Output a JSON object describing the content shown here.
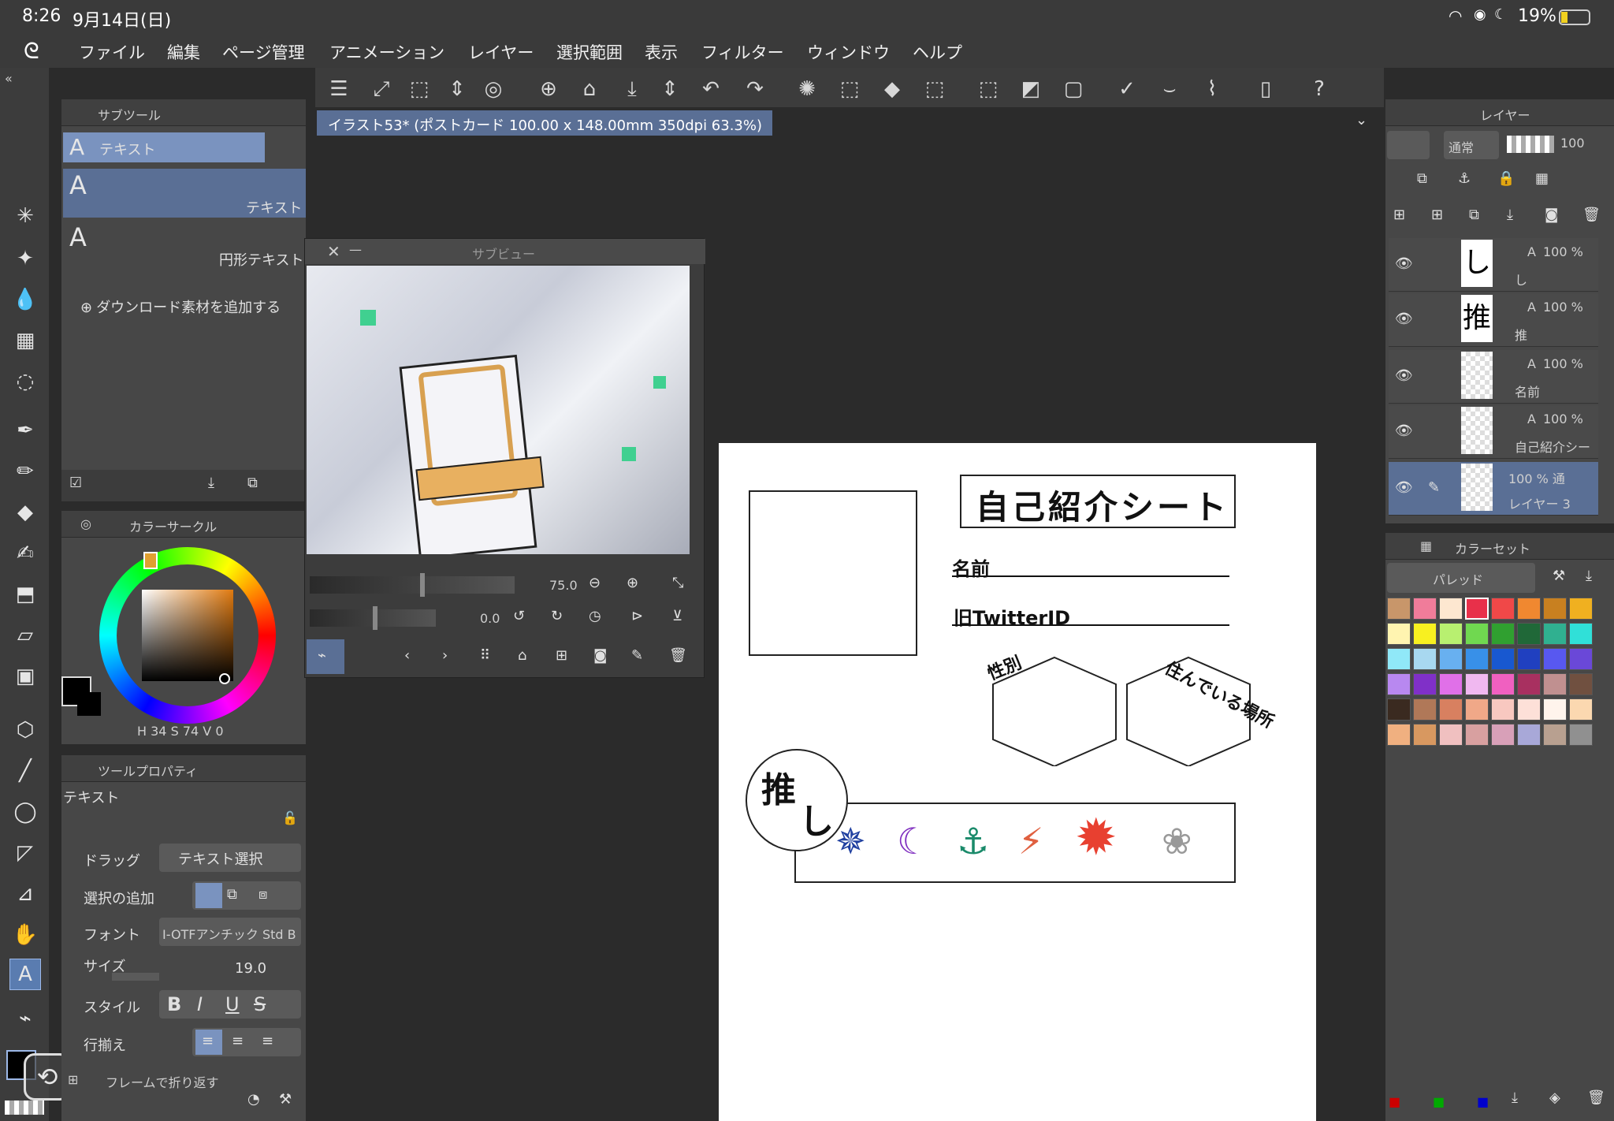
{
  "status": {
    "time": "8:26",
    "date": "9月14日(日)",
    "battery": "19%"
  },
  "menu": [
    "ファイル",
    "編集",
    "ページ管理",
    "アニメーション",
    "レイヤー",
    "選択範囲",
    "表示",
    "フィルター",
    "ウィンドウ",
    "ヘルプ"
  ],
  "document_tab": "イラスト53* (ポストカード 100.00 x 148.00mm 350dpi 63.3%)",
  "subtool": {
    "title": "サブツール",
    "items": [
      "テキスト",
      "テキスト",
      "円形テキスト"
    ],
    "add_material": "ダウンロード素材を追加する"
  },
  "subview": {
    "title": "サブビュー",
    "zoom": "75.0",
    "rotation": "0.0"
  },
  "color": {
    "title": "カラーサークル",
    "h": "34",
    "s": "74",
    "v": "0",
    "h_label": "H",
    "s_label": "S",
    "v_label": "V",
    "accent": "#e07a10"
  },
  "toolprop": {
    "title": "ツールプロパティ",
    "tool_name": "テキスト",
    "drag_label": "ドラッグ",
    "drag_value": "テキスト選択",
    "add_selection_label": "選択の追加",
    "font_label": "フォント",
    "font_value": "I-OTFアンチック Std B",
    "size_label": "サイズ",
    "size_value": "19.0",
    "style_label": "スタイル",
    "align_label": "行揃え",
    "wrap_label": "フレームで折り返す"
  },
  "layers": {
    "title": "レイヤー",
    "blend": "通常",
    "opacity": "100",
    "items": [
      {
        "thumb": "し",
        "opacity": "100 %",
        "name": "し"
      },
      {
        "thumb": "推",
        "opacity": "100 %",
        "name": "推"
      },
      {
        "thumb": "",
        "opacity": "100 %",
        "name": "名前"
      },
      {
        "thumb": "",
        "opacity": "100 %",
        "name": "自己紹介シー"
      },
      {
        "thumb": "",
        "opacity": "100 % 通",
        "name": "レイヤー 3"
      }
    ]
  },
  "colorset": {
    "title": "カラーセット",
    "palette": "パレッド",
    "colors": [
      "#c8966a",
      "#f07c9a",
      "#fde7d0",
      "#e8304a",
      "#f04848",
      "#f08830",
      "#c88020",
      "#f0b020",
      "#fff4b0",
      "#f8f020",
      "#b8f070",
      "#70d850",
      "#30a030",
      "#206838",
      "#30b090",
      "#30e0d8",
      "#90e8f8",
      "#a8d8f0",
      "#68b0f0",
      "#3890e8",
      "#1858d0",
      "#2040c0",
      "#5858f0",
      "#6a48d8",
      "#b888f0",
      "#8030c8",
      "#e070e8",
      "#f0b8f0",
      "#f060c0",
      "#a83060",
      "#c09090",
      "#705040",
      "#3a2a20",
      "#b07858",
      "#d88060",
      "#f0a888",
      "#f8c8c0",
      "#fde0d8",
      "#fff4ec",
      "#fbd8b0",
      "#f0b080",
      "#d89860",
      "#f0c0c0",
      "#d8a0a0",
      "#d8a0b8",
      "#a8a8d8",
      "#b8a090",
      "#909090"
    ]
  },
  "canvas": {
    "title": "自己紹介シート",
    "name_label": "名前",
    "twitter_label": "旧TwitterID",
    "gender_label": "性別",
    "location_label": "住んでいる場所",
    "oshi1": "推",
    "oshi2": "し"
  }
}
